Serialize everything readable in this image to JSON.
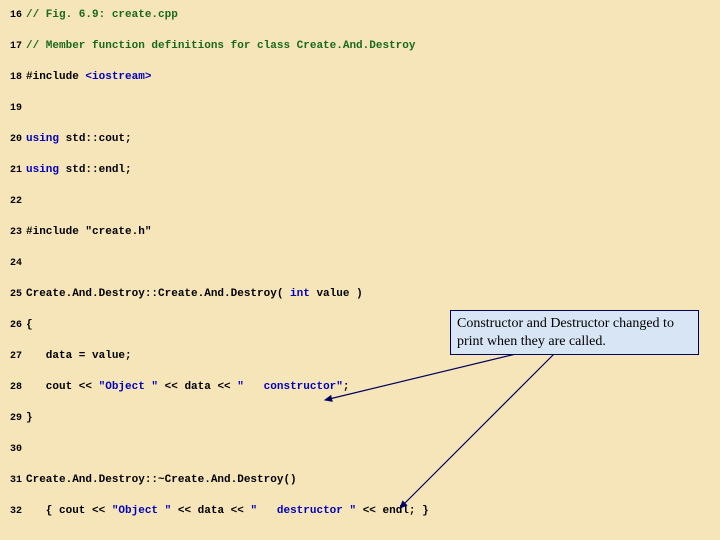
{
  "lines": [
    {
      "n": "16",
      "segs": [
        {
          "c": "comment",
          "t": "// Fig. 6.9: create.cpp"
        }
      ]
    },
    {
      "n": "17",
      "segs": [
        {
          "c": "comment",
          "t": "// Member function definitions for class Create.And.Destroy"
        }
      ]
    },
    {
      "n": "18",
      "segs": [
        {
          "c": "pp",
          "t": "#include "
        },
        {
          "c": "kw",
          "t": "<iostream>"
        }
      ]
    },
    {
      "n": "19",
      "segs": []
    },
    {
      "n": "20",
      "segs": [
        {
          "c": "kw",
          "t": "using"
        },
        {
          "c": "plain",
          "t": " std::cout;"
        }
      ]
    },
    {
      "n": "21",
      "segs": [
        {
          "c": "kw",
          "t": "using"
        },
        {
          "c": "plain",
          "t": " std::endl;"
        }
      ]
    },
    {
      "n": "22",
      "segs": []
    },
    {
      "n": "23",
      "segs": [
        {
          "c": "pp",
          "t": "#include "
        },
        {
          "c": "plain",
          "t": "\"create.h\""
        }
      ]
    },
    {
      "n": "24",
      "segs": []
    },
    {
      "n": "25",
      "segs": [
        {
          "c": "plain",
          "t": "Create.And.Destroy::Create.And.Destroy( "
        },
        {
          "c": "kw",
          "t": "int"
        },
        {
          "c": "plain",
          "t": " value )"
        }
      ]
    },
    {
      "n": "26",
      "segs": [
        {
          "c": "plain",
          "t": "{"
        }
      ]
    },
    {
      "n": "27",
      "segs": [
        {
          "c": "plain",
          "t": "   data = value;"
        }
      ]
    },
    {
      "n": "28",
      "segs": [
        {
          "c": "plain",
          "t": "   cout << "
        },
        {
          "c": "kw",
          "t": "\"Object \""
        },
        {
          "c": "plain",
          "t": " << data << "
        },
        {
          "c": "kw",
          "t": "\"   constructor\""
        },
        {
          "c": "plain",
          "t": ";"
        }
      ]
    },
    {
      "n": "29",
      "segs": [
        {
          "c": "plain",
          "t": "}"
        }
      ]
    },
    {
      "n": "30",
      "segs": []
    },
    {
      "n": "31",
      "segs": [
        {
          "c": "plain",
          "t": "Create.And.Destroy::~Create.And.Destroy()"
        }
      ]
    },
    {
      "n": "32",
      "segs": [
        {
          "c": "plain",
          "t": "   { cout << "
        },
        {
          "c": "kw",
          "t": "\"Object \""
        },
        {
          "c": "plain",
          "t": " << data << "
        },
        {
          "c": "kw",
          "t": "\"   destructor \""
        },
        {
          "c": "plain",
          "t": " << endl; }"
        }
      ]
    }
  ],
  "callout": {
    "text": "Constructor and Destructor changed to print when they are called."
  }
}
